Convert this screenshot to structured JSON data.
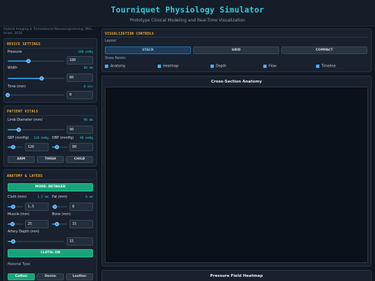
{
  "header": {
    "title": "Tourniquet Physiology Simulator",
    "subtitle": "Prototype Clinical Modeling and Real-Time Visualization"
  },
  "citation": "Optical Imaging & Translational Neuroengineering, INEL, Israel, 2026",
  "device_settings": {
    "title": "DEVICE SETTINGS",
    "pressure": {
      "label": "Pressure",
      "display": "180 mmHg",
      "value": "180",
      "level": 0.36
    },
    "width": {
      "label": "Width",
      "display": "80 mm",
      "value": "80",
      "level": 0.6
    },
    "time": {
      "label": "Time (min)",
      "display": "0 min",
      "value": "0",
      "level": 0.0
    }
  },
  "patient_vitals": {
    "title": "PATIENT VITALS",
    "limb_diameter": {
      "label": "Limb Diameter (mm)",
      "display": "90 mm",
      "value": "90",
      "level": 0.2
    },
    "sbp": {
      "label": "SBP (mmHg)",
      "display": "120 mmHg",
      "value": "120",
      "level": 0.35
    },
    "dbp": {
      "label": "DBP (mmHg)",
      "display": "80 mmHg",
      "value": "80",
      "level": 0.3
    },
    "buttons": [
      "ARM",
      "THIGH",
      "CHILD"
    ]
  },
  "anatomy_layers": {
    "title": "ANATOMY & LAYERS",
    "mode_button": "MODE: DETAILED",
    "cloth": {
      "label": "Cloth (mm)",
      "display": "1.5 mm",
      "value": "1.5",
      "level": 0.35
    },
    "fat": {
      "label": "Fat (mm)",
      "display": "8 mm",
      "value": "8",
      "level": 0.2
    },
    "muscle": {
      "label": "Muscle (mm)",
      "value": "25",
      "level": 0.3
    },
    "bone": {
      "label": "Bone (mm)",
      "value": "15",
      "level": 0.3
    },
    "artery_depth": {
      "label": "Artery Depth (mm)",
      "value": "15",
      "level": 0.1
    },
    "cloth_button": "CLOTH: ON",
    "material_label": "Material Type:",
    "materials": [
      "Cotton",
      "Denim",
      "Leather"
    ]
  },
  "visualization_controls": {
    "title": "VISUALIZATION CONTROLS",
    "layout_label": "Layout",
    "layouts": [
      "STACK",
      "GRID",
      "COMPACT"
    ],
    "active_layout": "STACK",
    "show_panels_label": "Show Panels",
    "panels": [
      "Anatomy",
      "Heatmap",
      "Depth",
      "Flow",
      "Timeline"
    ]
  },
  "views": {
    "cross_section": "Cross-Section Anatomy",
    "heatmap": "Pressure Field Heatmap"
  },
  "colors": {
    "accent": "#35c9d8",
    "section_title": "#e7a83b",
    "active_button": "#1aa37a",
    "slider": "#3aa3f0"
  }
}
